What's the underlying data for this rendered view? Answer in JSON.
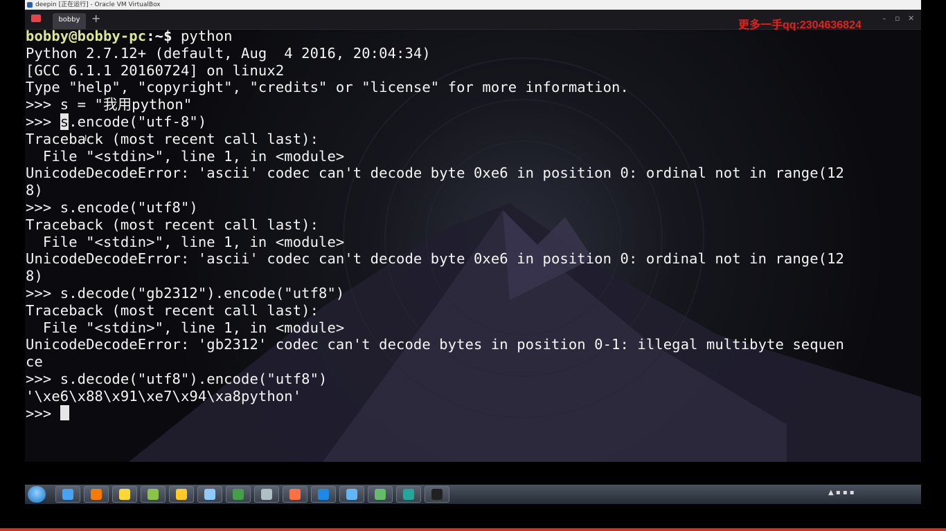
{
  "host_window": {
    "title": "deepin [正在运行] - Oracle VM VirtualBox"
  },
  "watermark": "更多一手qq:2304636824",
  "terminal_tab": {
    "label": "bobby",
    "add_symbol": "+"
  },
  "window_controls": {
    "minimize": "–",
    "maximize": "▫",
    "close": "✕"
  },
  "prompt": {
    "user_host": "bobby@bobby-pc",
    "path_suffix": ":~$",
    "command": " python"
  },
  "terminal_lines": [
    "Python 2.7.12+ (default, Aug  4 2016, 20:04:34)",
    "[GCC 6.1.1 20160724] on linux2",
    "Type \"help\", \"copyright\", \"credits\" or \"license\" for more information.",
    ">>> s = \"我用python\"",
    ">>> ",
    "s",
    ".encode(\"utf-8\")",
    "Traceback (most recent call last):",
    "  File \"<stdin>\", line 1, in <module>",
    "UnicodeDecodeError: 'ascii' codec can't decode byte 0xe6 in position 0: ordinal not in range(12",
    "8)",
    ">>> s.encode(\"utf8\")",
    "Traceback (most recent call last):",
    "  File \"<stdin>\", line 1, in <module>",
    "UnicodeDecodeError: 'ascii' codec can't decode byte 0xe6 in position 0: ordinal not in range(12",
    "8)",
    ">>> s.decode(\"gb2312\").encode(\"utf8\")",
    "Traceback (most recent call last):",
    "  File \"<stdin>\", line 1, in <module>",
    "UnicodeDecodeError: 'gb2312' codec can't decode bytes in position 0-1: illegal multibyte sequen",
    "ce",
    ">>> s.decode(\"utf8\").encode(\"utf8\")",
    "'\\xe6\\x88\\x91\\xe7\\x94\\xa8python'",
    ">>> "
  ],
  "dock_icons": [
    {
      "name": "launcher-icon",
      "color": "#8b6cf0"
    },
    {
      "name": "multitask-view-icon",
      "color": "#5b7bd8"
    },
    {
      "name": "chat-icon",
      "color": "#2ecc71"
    },
    {
      "name": "file-manager-icon",
      "color": "#4fc3f7"
    },
    {
      "name": "app-store-icon",
      "color": "#f39c12"
    },
    {
      "name": "installer-icon",
      "color": "#7cb342"
    },
    {
      "name": "video-player-icon",
      "color": "#29b6f6"
    },
    {
      "name": "chrome-icon",
      "color": "#e74c3c"
    },
    {
      "name": "settings-icon",
      "color": "#d0d0d0"
    },
    {
      "name": "terminal-icon",
      "color": "#e53935"
    },
    {
      "name": "network-icon",
      "color": "#5c6bc0"
    },
    {
      "name": "power-icon",
      "color": "#ab47bc"
    },
    {
      "name": "music-icon",
      "color": "#ffb74d"
    },
    {
      "name": "screenshot-icon",
      "color": "#26c6da"
    },
    {
      "name": "speed-monitor-icon",
      "color": "#f5f5f5"
    },
    {
      "name": "trash-icon",
      "color": "#9ccc65"
    }
  ],
  "taskbar_icons": [
    {
      "name": "ie-icon",
      "color": "#4aa3f0"
    },
    {
      "name": "firefox-icon",
      "color": "#f57c00"
    },
    {
      "name": "media-icon",
      "color": "#fdd835"
    },
    {
      "name": "notes-icon",
      "color": "#8bc34a"
    },
    {
      "name": "folder-icon",
      "color": "#ffca28"
    },
    {
      "name": "monitor-icon",
      "color": "#90caf9"
    },
    {
      "name": "game-icon",
      "color": "#43a047"
    },
    {
      "name": "tools-icon",
      "color": "#b0bec5"
    },
    {
      "name": "ppt-icon",
      "color": "#ff7043"
    },
    {
      "name": "word-icon",
      "color": "#1e88e5"
    },
    {
      "name": "virtualbox-icon",
      "color": "#64b5f6"
    },
    {
      "name": "qq-icon",
      "color": "#66bb6a"
    },
    {
      "name": "camtasia-icon",
      "color": "#26a69a"
    },
    {
      "name": "cmd-icon",
      "color": "#212121"
    }
  ]
}
